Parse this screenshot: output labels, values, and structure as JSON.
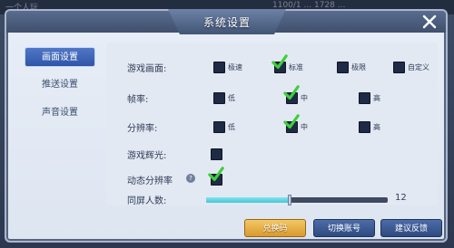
{
  "background": {
    "hud_left": "一个人玩",
    "hud_right": "1100/1 ... 1728 ..."
  },
  "dialog": {
    "title": "系统设置",
    "close_icon": "close-icon"
  },
  "sidebar": {
    "items": [
      {
        "label": "画面设置",
        "active": true
      },
      {
        "label": "推送设置",
        "active": false
      },
      {
        "label": "声音设置",
        "active": false
      }
    ]
  },
  "settings": {
    "graphics": {
      "label": "游戏画面:",
      "options": [
        "极速",
        "标准",
        "极限",
        "自定义"
      ],
      "selected": "标准"
    },
    "framerate": {
      "label": "帧率:",
      "options": [
        "低",
        "中",
        "高"
      ],
      "selected": "中"
    },
    "resolution": {
      "label": "分辨率:",
      "options": [
        "低",
        "中",
        "高"
      ],
      "selected": "中"
    },
    "bloom": {
      "label": "游戏辉光:",
      "checked": false
    },
    "dynamic_resolution": {
      "label": "动态分辨率",
      "help": "?",
      "checked": true
    },
    "players_on_screen": {
      "label": "同屏人数:",
      "value": "12",
      "fill_fraction": 0.46
    }
  },
  "buttons": {
    "redeem": "兑换码",
    "switch_account": "切换账号",
    "feedback": "建议反馈"
  },
  "colors": {
    "accent_blue": "#2f55a8",
    "check_green": "#3fcf3a",
    "slider_teal": "#4ac4d2",
    "gold": "#d99a2d"
  }
}
